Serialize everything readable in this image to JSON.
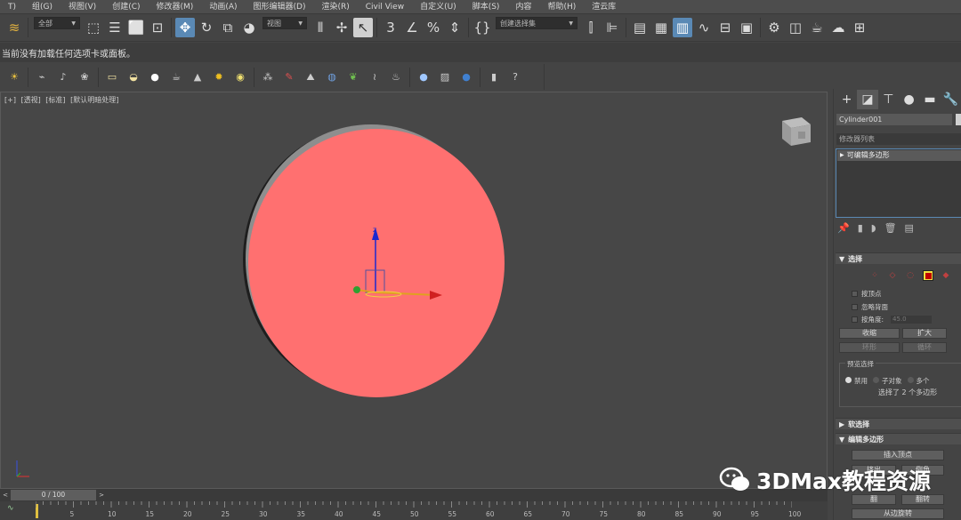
{
  "menu": [
    "T)",
    "组(G)",
    "视图(V)",
    "创建(C)",
    "修改器(M)",
    "动画(A)",
    "图形编辑器(D)",
    "渲染(R)",
    "Civil View",
    "自定义(U)",
    "脚本(S)",
    "内容",
    "帮助(H)",
    "渲云库"
  ],
  "toolbar": {
    "selection_filter": "全部",
    "reference_coord": "视图",
    "named_selection": "创建选择集"
  },
  "prompt_text": "当前没有加载任何选项卡或面板。",
  "viewport": {
    "label_plus": "[+]",
    "label_view": "[透视]",
    "label_shading": "[标准]",
    "label_lighting": "[默认明暗处理]",
    "object_color": "#ff7070",
    "gizmo_z": "z"
  },
  "command_panel": {
    "object_name": "Cylinder001",
    "modifier_list": "修改器列表",
    "stack_item": "可编辑多边形",
    "selection_rollout": "选择",
    "by_vertex": "按顶点",
    "ignore_backfacing": "忽略背面",
    "by_angle": "按角度:",
    "by_angle_value": "45.0",
    "shrink": "收缩",
    "grow": "扩大",
    "ring": "环形",
    "loop": "循环",
    "preview_selection": "预览选择",
    "disabled": "禁用",
    "subobject": "子对象",
    "multi": "多个",
    "selection_info": "选择了 2 个多边形",
    "soft_selection": "软选择",
    "edit_polygons": "编辑多边形",
    "insert_vertex": "插入顶点",
    "extrude": "挤出",
    "bevel": "倒角",
    "flip": "翻",
    "flip2": "翻转",
    "hinge": "从边旋转"
  },
  "timeline": {
    "frame": "0 / 100",
    "ticks": [
      "5",
      "10",
      "15",
      "20",
      "25",
      "30",
      "35",
      "40",
      "45",
      "50",
      "55",
      "60",
      "65",
      "70",
      "75",
      "80",
      "85",
      "90",
      "95",
      "100"
    ]
  },
  "watermark": "3DMax教程资源"
}
